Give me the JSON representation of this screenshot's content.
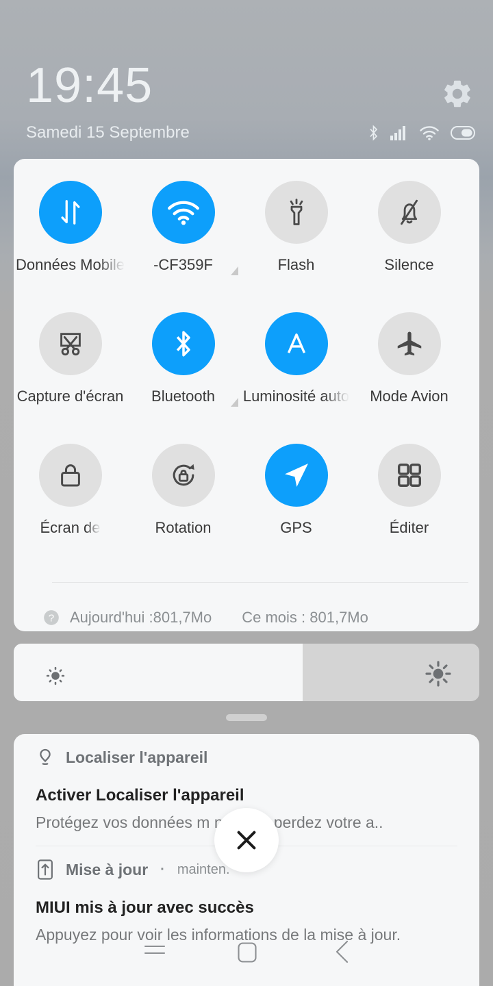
{
  "status_bar": {
    "time": "19:45",
    "date": "Samedi 15 Septembre",
    "settings_icon": "gear-icon",
    "icons": [
      "bluetooth-icon",
      "signal-bars-icon",
      "wifi-icon",
      "battery-icon"
    ]
  },
  "quick_settings": {
    "tiles": [
      {
        "label": "Données Mobile",
        "icon": "mobile-data-icon",
        "active": true,
        "truncated": true,
        "marker": false
      },
      {
        "label": "-CF359F",
        "icon": "wifi-icon",
        "active": true,
        "truncated": false,
        "marker": true
      },
      {
        "label": "Flash",
        "icon": "flashlight-icon",
        "active": false,
        "truncated": false,
        "marker": false
      },
      {
        "label": "Silence",
        "icon": "bell-mute-icon",
        "active": false,
        "truncated": false,
        "marker": false
      },
      {
        "label": "Capture d'écran",
        "icon": "screenshot-icon",
        "active": false,
        "truncated": false,
        "marker": false
      },
      {
        "label": "Bluetooth",
        "icon": "bluetooth-icon",
        "active": true,
        "truncated": false,
        "marker": true
      },
      {
        "label": "Luminosité auto",
        "icon": "auto-brightness-icon",
        "active": true,
        "truncated": true,
        "marker": false
      },
      {
        "label": "Mode Avion",
        "icon": "airplane-icon",
        "active": false,
        "truncated": false,
        "marker": false
      },
      {
        "label": "Écran de",
        "icon": "lock-icon",
        "active": false,
        "truncated": true,
        "marker": false
      },
      {
        "label": "Rotation",
        "icon": "rotation-lock-icon",
        "active": false,
        "truncated": false,
        "marker": false
      },
      {
        "label": "GPS",
        "icon": "navigation-arrow-icon",
        "active": true,
        "truncated": false,
        "marker": false
      },
      {
        "label": "Éditer",
        "icon": "grid-icon",
        "active": false,
        "truncated": false,
        "marker": false
      }
    ],
    "ghost_fragment": "e",
    "data_usage": {
      "help_icon": "question-mark-icon",
      "today": "Aujourd'hui :801,7Mo",
      "this_month": "Ce mois : 801,7Mo"
    }
  },
  "brightness": {
    "low_icon": "brightness-low-icon",
    "high_icon": "brightness-high-icon",
    "fill_percent": 62
  },
  "notifications": [
    {
      "app": "Localiser l'appareil",
      "app_icon": "location-pin-icon",
      "time": "",
      "title": "Activer Localiser l'appareil",
      "body": "Protégez vos données m           nd vous perdez votre a.."
    },
    {
      "app": "Mise à jour",
      "app_icon": "update-arrow-icon",
      "time": "mainten.",
      "separator": "·",
      "title": "MIUI mis à jour avec succès",
      "body": "Appuyez pour voir les informations de la mise à jour."
    }
  ],
  "close_button": {
    "icon": "close-icon",
    "label": "×"
  },
  "nav_bar": {
    "recents_icon": "recents-icon",
    "home_icon": "home-icon",
    "back_icon": "back-icon"
  },
  "colors": {
    "accent": "#0d9ffb",
    "tile_off": "#e0e0e0",
    "panel_bg": "#f6f7f8",
    "backdrop": "#ababab"
  }
}
